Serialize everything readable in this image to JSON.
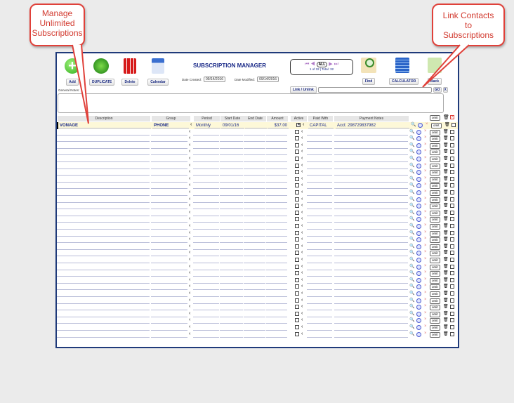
{
  "callouts": {
    "left": "Manage Unlimited Subscriptions",
    "right": "Link Contacts to Subscriptions"
  },
  "toolbar": {
    "add": "Add",
    "duplicate": "DUPLICATE",
    "delete": "Delete",
    "calendar": "Calendar",
    "find": "Find",
    "calculator": "CALCULATOR",
    "back": "Back"
  },
  "header": {
    "title": "SUBSCRIPTION MANAGER",
    "date_created_label": "Date Created:",
    "date_created": "09/14/2016",
    "date_modified_label": "Date Modified:",
    "date_modified": "09/14/2016"
  },
  "nav": {
    "all": "ALL",
    "status": "1 of 32 | Total: 32"
  },
  "link": {
    "label": "Link / Unlink",
    "go": "GO",
    "x": "X",
    "value": ""
  },
  "notes": {
    "label": "General Notes:",
    "value": ""
  },
  "columns": [
    "Description",
    "Group",
    "Period",
    "Start Date",
    "End Date",
    "Amount",
    "Active",
    "Paid With",
    "Payment Notes"
  ],
  "omit_label": "omit",
  "row_count": 32,
  "rows": [
    {
      "description": "VONAGE",
      "group": "PHONE",
      "period": "Monthly",
      "start_date": "09/01/16",
      "end_date": "",
      "amount": "$37.00",
      "active": true,
      "paid_with": "CAPITAL",
      "payment_notes": "Acct: 298729837982"
    }
  ],
  "colors": {
    "frame": "#1f3a7a",
    "accent": "#e0413a",
    "highlight": "#fdf8d8",
    "text": "#1a2a88"
  }
}
